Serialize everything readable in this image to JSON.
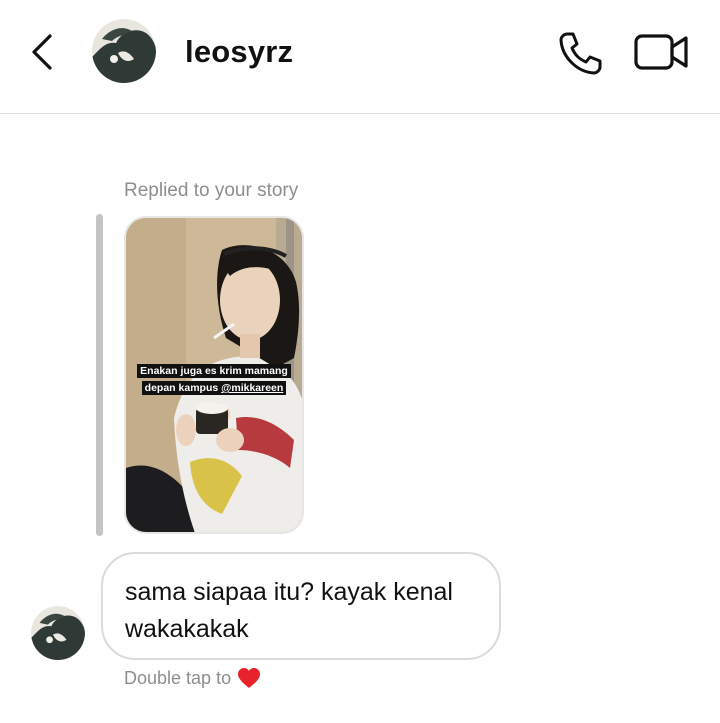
{
  "header": {
    "username": "leosyrz",
    "back_icon": "chevron-left-icon",
    "call_icon": "phone-icon",
    "video_icon": "video-camera-icon"
  },
  "thread": {
    "reply_label": "Replied to your story",
    "story": {
      "caption_line1": "Enakan juga es krim mamang",
      "caption_line2": "depan kampus",
      "mention": "@mikkareen"
    },
    "message": {
      "text": "sama siapaa itu? kayak kenal wakakakak"
    },
    "double_tap_text": "Double tap to",
    "heart_color": "#e8222a"
  },
  "colors": {
    "accent_text": "#111111",
    "muted_text": "#8e8e8e",
    "border": "#dbdbdb"
  }
}
